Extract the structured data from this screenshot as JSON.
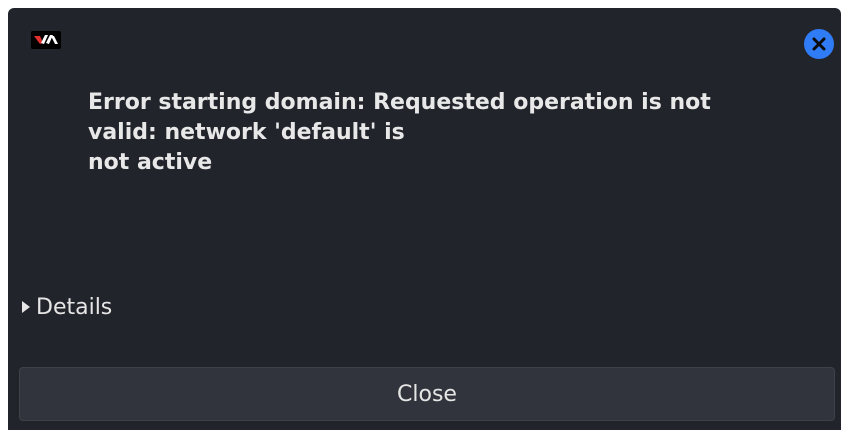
{
  "dialog": {
    "app_icon": "virt-manager-icon",
    "close_icon": "close-icon",
    "message_lines": [
      "Error starting domain: Requested operation is not",
      "valid: network 'default' is",
      "not active"
    ],
    "details_label": "Details",
    "close_button_label": "Close"
  },
  "colors": {
    "background": "#22242b",
    "accent": "#2f7cf6",
    "button": "#31343c",
    "text": "#e6e6e6"
  }
}
